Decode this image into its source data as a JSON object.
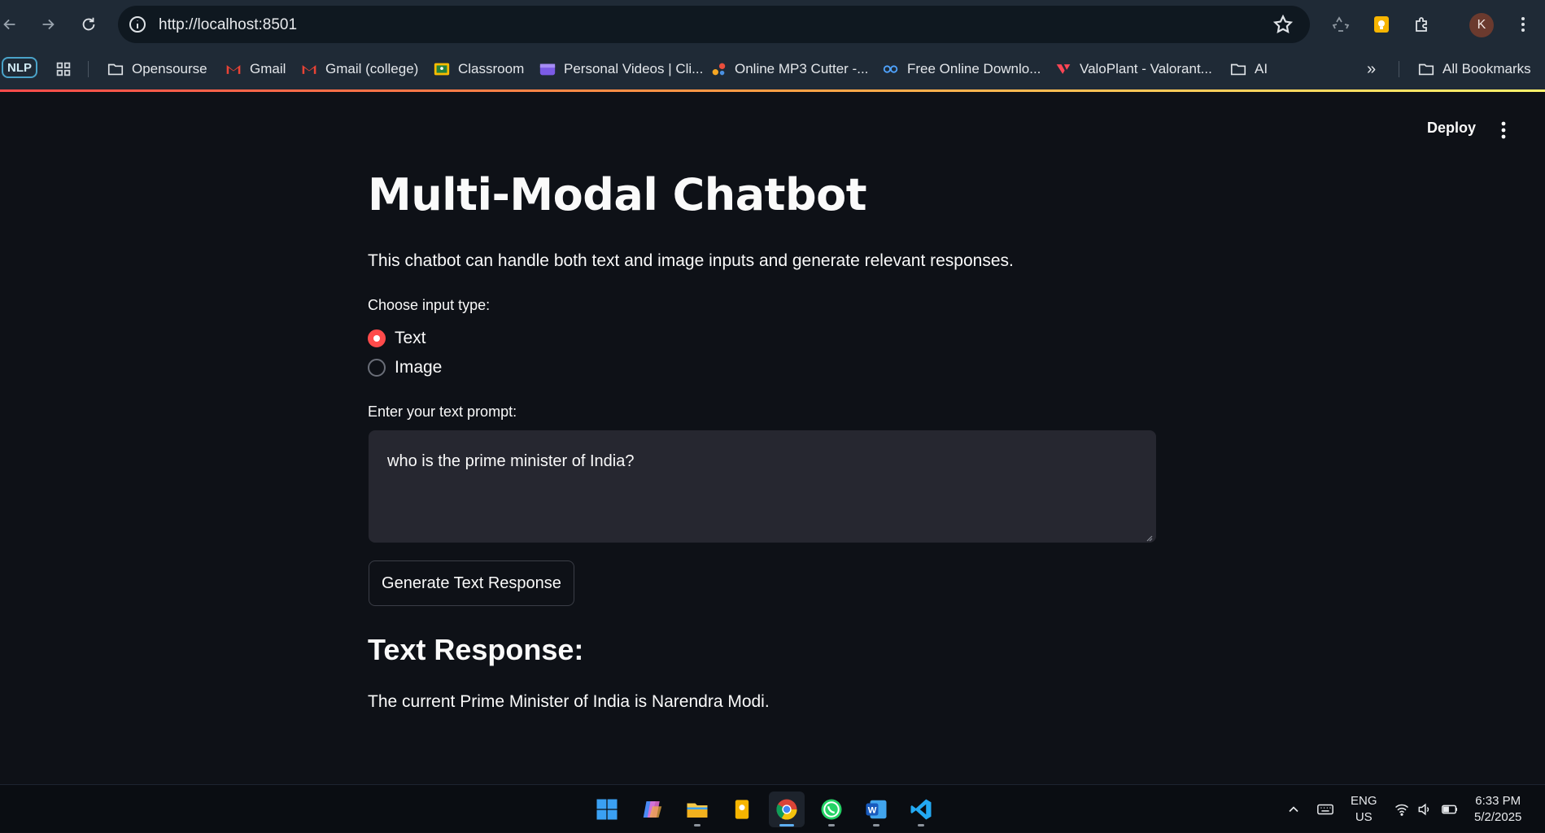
{
  "browser": {
    "url": "http://localhost:8501",
    "avatar_letter": "K",
    "bookmarks": [
      {
        "label": "NLP"
      },
      {
        "label": "Opensourse"
      },
      {
        "label": "Gmail"
      },
      {
        "label": "Gmail (college)"
      },
      {
        "label": "Classroom"
      },
      {
        "label": "Personal Videos | Cli..."
      },
      {
        "label": "Online MP3 Cutter -..."
      },
      {
        "label": "Free Online Downlo..."
      },
      {
        "label": "ValoPlant - Valorant..."
      },
      {
        "label": "AI"
      },
      {
        "label": "All Bookmarks"
      }
    ]
  },
  "app": {
    "deploy_label": "Deploy",
    "title": "Multi-Modal Chatbot",
    "description": "This chatbot can handle both text and image inputs and generate relevant responses.",
    "input_type_label": "Choose input type:",
    "options": [
      "Text",
      "Image"
    ],
    "selected_option": "Text",
    "prompt_label": "Enter your text prompt:",
    "prompt_value": "who is the prime minister of India?",
    "generate_button": "Generate Text Response",
    "response_heading": "Text Response:",
    "response_text": "The current Prime Minister of India is Narendra Modi."
  },
  "taskbar": {
    "language": "ENG",
    "region": "US",
    "time": "6:33 PM",
    "date": "5/2/2025",
    "apps": [
      "windows-start-icon",
      "copilot-icon",
      "file-explorer-icon",
      "notes-icon",
      "chrome-icon",
      "whatsapp-icon",
      "word-icon",
      "vscode-icon"
    ]
  },
  "colors": {
    "accent": "#ff4b4b",
    "background": "#0e1117",
    "input_bg": "#262730",
    "browser_bar": "#1f2a36"
  }
}
